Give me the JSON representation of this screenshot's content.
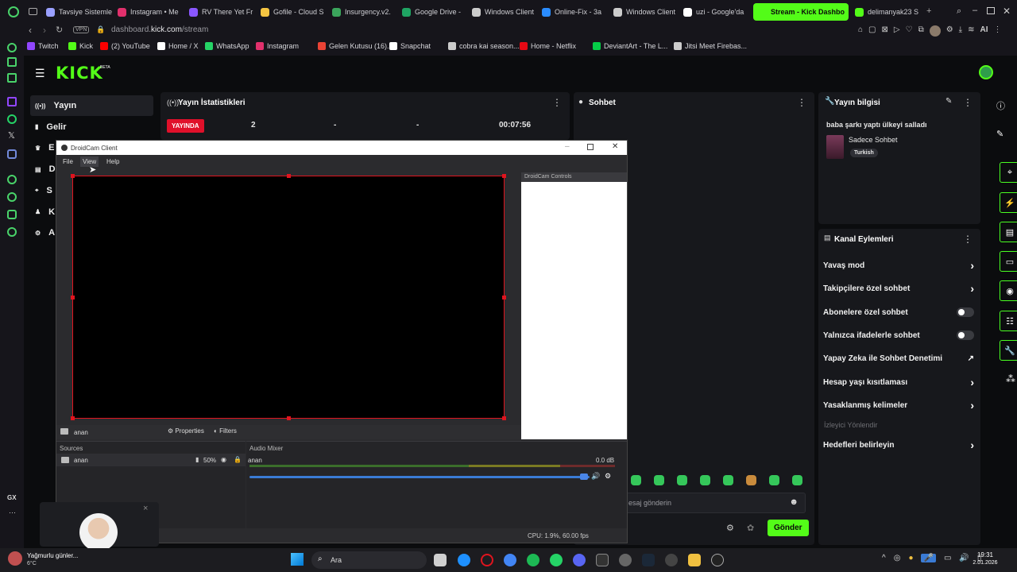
{
  "browser": {
    "tabs": [
      {
        "label": "Tavsiye Sistemle",
        "color": "#9aa0ff"
      },
      {
        "label": "Instagram • Me",
        "color": "#e1306c"
      },
      {
        "label": "RV There Yet Fr",
        "color": "#8a57ff"
      },
      {
        "label": "Gofile - Cloud S",
        "color": "#f5c542"
      },
      {
        "label": "Insurgency.v2.",
        "color": "#3ba55c"
      },
      {
        "label": "Google Drive - ",
        "color": "#1fa463"
      },
      {
        "label": "Windows Client",
        "color": "#cccccc"
      },
      {
        "label": "Online-Fix - 3a",
        "color": "#2a8cff"
      },
      {
        "label": "Windows Client",
        "color": "#cccccc"
      },
      {
        "label": "uzi - Google'da",
        "color": "#ffffff"
      },
      {
        "label": "Stream - Kick Dashbo",
        "color": "#53fc18"
      },
      {
        "label": "delimanyak23 S",
        "color": "#53fc18"
      }
    ],
    "url_host": "dashboard.",
    "url_domain": "kick.com",
    "url_path": "/stream",
    "vpn_label": "VPN",
    "ai_label": "AI",
    "bookmarks": [
      {
        "label": "Twitch",
        "color": "#9146ff"
      },
      {
        "label": "Kick",
        "color": "#53fc18"
      },
      {
        "label": "(2) YouTube",
        "color": "#ff0000"
      },
      {
        "label": "Home / X",
        "color": "#ffffff"
      },
      {
        "label": "WhatsApp",
        "color": "#25d366"
      },
      {
        "label": "Instagram",
        "color": "#e1306c"
      },
      {
        "label": "Gelen Kutusu (16)...",
        "color": "#ea4335"
      },
      {
        "label": "Snapchat",
        "color": "#ffffff"
      },
      {
        "label": "cobra kai season...",
        "color": "#cccccc"
      },
      {
        "label": "Home - Netflix",
        "color": "#e50914"
      },
      {
        "label": "DeviantArt - The L...",
        "color": "#05cc47"
      },
      {
        "label": "Jitsi Meet Firebas...",
        "color": "#cccccc"
      }
    ]
  },
  "kick": {
    "logo": "KICK",
    "logo_badge": "BETA",
    "nav": [
      {
        "label": "Yayın",
        "icon": "broadcast-icon"
      },
      {
        "label": "Gelir",
        "icon": "revenue-icon"
      },
      {
        "label": "E",
        "icon": "trophy-icon"
      },
      {
        "label": "D",
        "icon": "library-icon"
      },
      {
        "label": "S",
        "icon": "security-icon"
      },
      {
        "label": "K",
        "icon": "community-icon"
      },
      {
        "label": "A",
        "icon": "settings-icon"
      }
    ],
    "stats": {
      "title": "Yayın İstatistikleri",
      "live_badge": "YAYINDA",
      "viewers": "2",
      "stat2": "-",
      "stat3": "-",
      "duration": "00:07:56"
    },
    "chat": {
      "title": "Sohbet",
      "input_placeholder": "esaj gönderin",
      "send_label": "Gönder"
    },
    "stream_info": {
      "title": "Yayın bilgisi",
      "stream_title": "baba şarkı yaptı ülkeyi salladı",
      "category": "Sadece Sohbet",
      "language": "Turkish"
    },
    "channel_actions": {
      "title": "Kanal Eylemleri",
      "items": [
        {
          "label": "Yavaş mod",
          "control": "chevron"
        },
        {
          "label": "Takipçilere özel sohbet",
          "control": "chevron"
        },
        {
          "label": "Abonelere özel sohbet",
          "control": "toggle",
          "on": false
        },
        {
          "label": "Yalnızca ifadelerle sohbet",
          "control": "toggle",
          "on": false
        },
        {
          "label": "Yapay Zeka ile Sohbet Denetimi",
          "control": "external"
        },
        {
          "label": "Hesap yaşı kısıtlaması",
          "control": "chevron"
        },
        {
          "label": "Yasaklanmış kelimeler",
          "control": "chevron"
        }
      ],
      "section_label": "İzleyici Yönlendir",
      "last_item": "Hedefleri belirleyin"
    }
  },
  "droidcam": {
    "title": "DroidCam Client",
    "menu": [
      "File",
      "View",
      "Help"
    ],
    "controls_title": "DroidCam Controls",
    "source_name": "anan",
    "properties_label": "Properties",
    "filters_label": "Filters",
    "sources_title": "Sources",
    "source_volume": "50%",
    "mixer_title": "Audio Mixer",
    "mixer_track": "anan",
    "mixer_db": "0.0 dB",
    "status": "CPU: 1.9%, 60.00 fps"
  },
  "webcam_overlay": {
    "close": "×"
  },
  "taskbar": {
    "weather_text": "Yağmurlu günler...",
    "weather_temp": "6°C",
    "search_label": "Ara",
    "time": "19:31",
    "date": "2.01.2026"
  }
}
